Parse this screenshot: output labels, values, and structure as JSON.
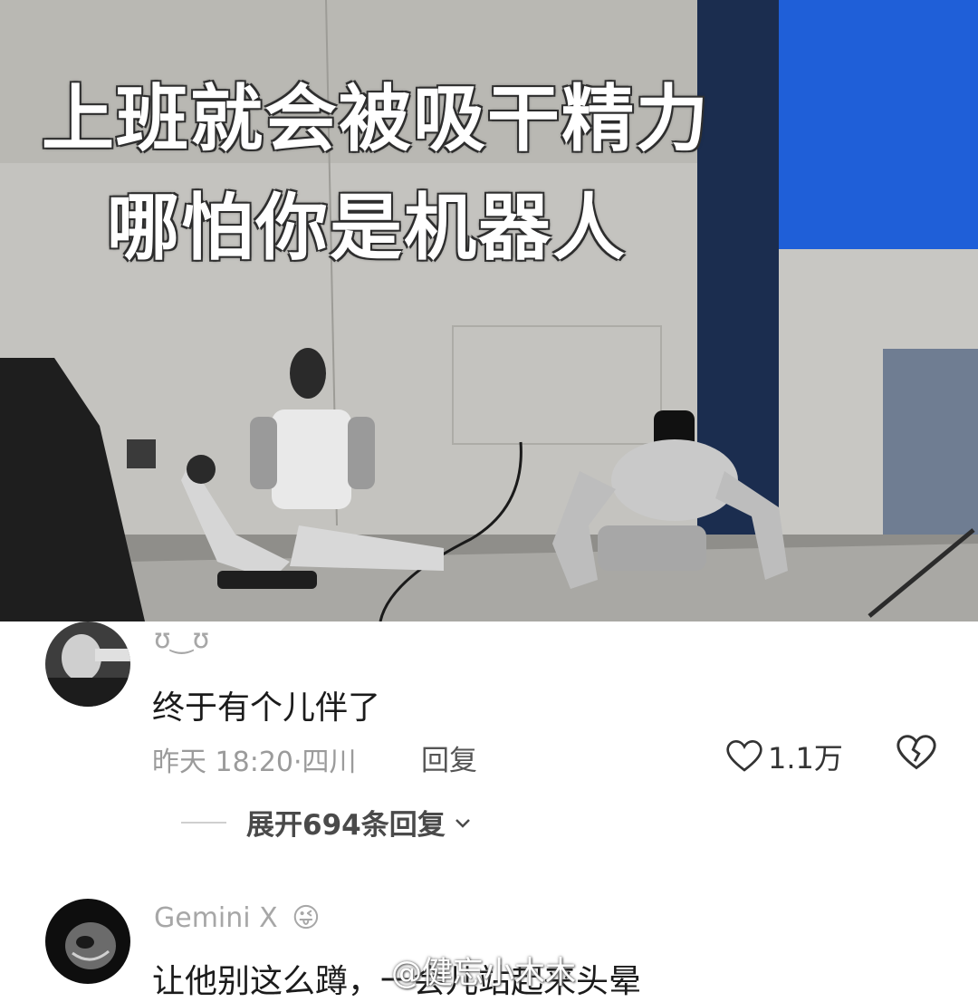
{
  "video": {
    "caption_line1": "上班就会被吸干精力",
    "caption_line2": "哪怕你是机器人"
  },
  "comments": [
    {
      "username": "ʊ‿ʊ",
      "text": "终于有个儿伴了",
      "time": "昨天 18:20·四川",
      "reply_label": "回复",
      "likes": "1.1万",
      "expand_label": "展开694条回复",
      "avatar_icon": "avatar-photo"
    },
    {
      "username": "Gemini X",
      "emoji": "😜",
      "text": "让他别这么蹲，一会儿站起来头晕",
      "avatar_icon": "avatar-photo"
    }
  ],
  "watermark": "@健忘小木木",
  "colors": {
    "text": "#1b1b1b",
    "muted": "#9b9b9b",
    "curtain": "#1b2d4f",
    "screen": "#1f5fd8"
  }
}
